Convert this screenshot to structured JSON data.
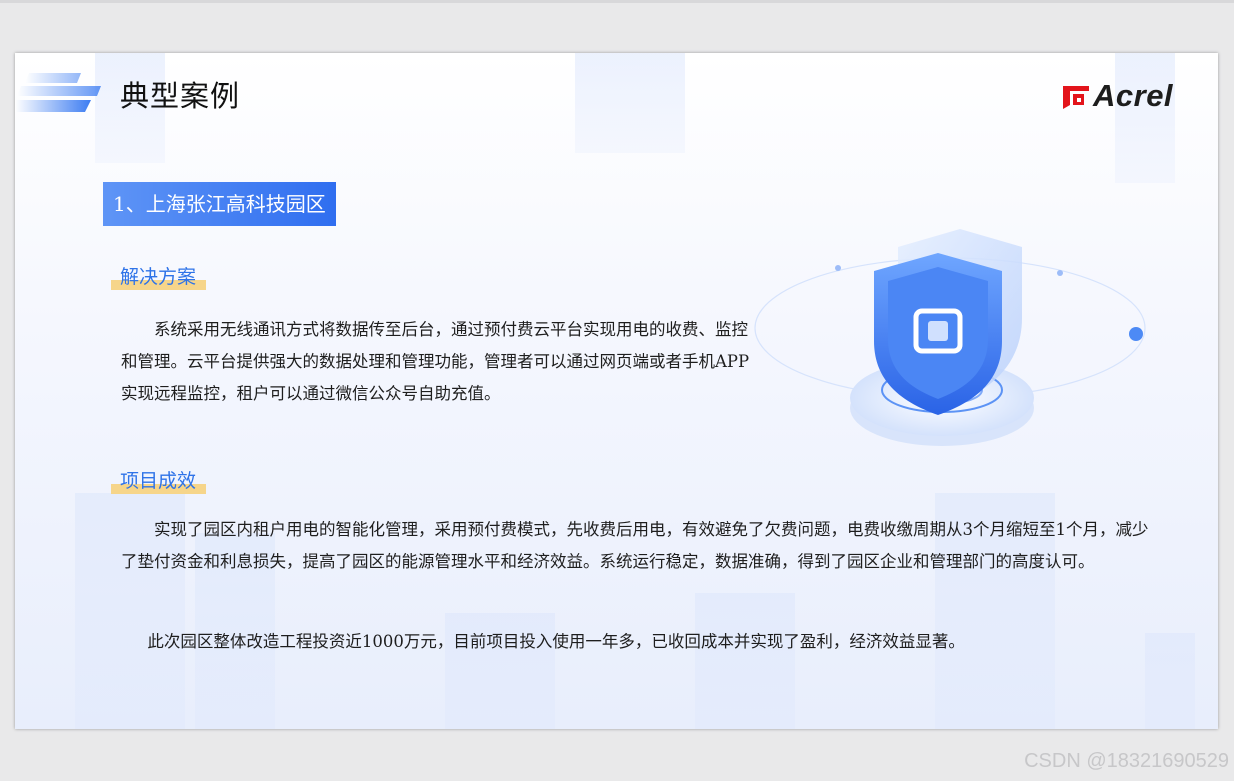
{
  "slide": {
    "title": "典型案例",
    "brand": {
      "name": "Acrel",
      "logo_red": "#e3141b"
    },
    "case_label": "1、上海张江高科技园区",
    "sections": [
      {
        "heading": "解决方案",
        "paragraphs": [
          "系统采用无线通讯方式将数据传至后台，通过预付费云平台实现用电的收费、监控和管理。云平台提供强大的数据处理和管理功能，管理者可以通过网页端或者手机APP实现远程监控，租户可以通过微信公众号自助充值。"
        ]
      },
      {
        "heading": "项目成效",
        "paragraphs": [
          "实现了园区内租户用电的智能化管理，采用预付费模式，先收费后用电，有效避免了欠费问题，电费收缴周期从3个月缩短至1个月，减少了垫付资金和利息损失，提高了园区的能源管理水平和经济效益。系统运行稳定，数据准确，得到了园区企业和管理部门的高度认可。",
          "此次园区整体改造工程投资近1000万元，目前项目投入使用一年多，已收回成本并实现了盈利，经济效益显著。"
        ]
      }
    ],
    "illustration_icon": "security-shield-icon",
    "colors": {
      "accent_blue": "#2f6ef0",
      "heading_blue": "#2e73e8",
      "highlight_yellow": "#f6d58a"
    }
  },
  "watermark": "CSDN @18321690529"
}
